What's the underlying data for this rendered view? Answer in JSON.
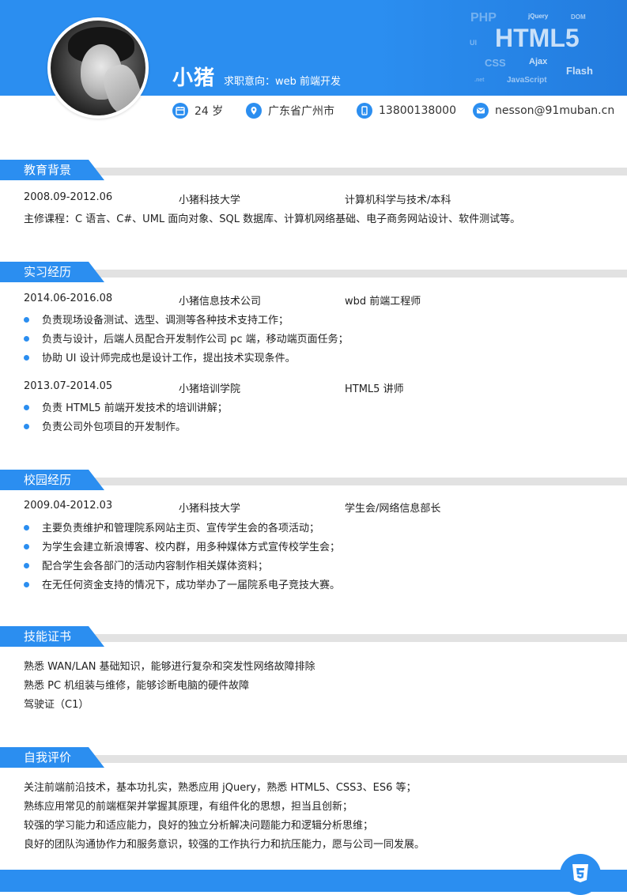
{
  "header": {
    "name": "小猪",
    "intent": "求职意向：web 前端开发",
    "keywords": {
      "html5": "HTML5",
      "php": "PHP",
      "jquery": "jQuery",
      "dom": "DOM",
      "ui": "UI",
      "css": "CSS",
      "ajax": "Ajax",
      "flash": "Flash",
      "javascript": "JavaScript",
      "net": ".net"
    }
  },
  "info": {
    "age": "24 岁",
    "city": "广东省广州市",
    "phone": "13800138000",
    "email": "nesson@91muban.cn"
  },
  "education": {
    "title": "教育背景",
    "period": "2008.09-2012.06",
    "school": "小猪科技大学",
    "major": "计算机科学与技术/本科",
    "courses": "主修课程：C 语言、C#、UML 面向对象、SQL 数据库、计算机网络基础、电子商务网站设计、软件测试等。"
  },
  "internship": {
    "title": "实习经历",
    "jobs": [
      {
        "period": "2014.06-2016.08",
        "company": "小猪信息技术公司",
        "role": "wbd 前端工程师",
        "duties": [
          "负责现场设备测试、选型、调测等各种技术支持工作；",
          "负责与设计，后端人员配合开发制作公司 pc 端，移动端页面任务；",
          "协助 UI 设计师完成也是设计工作，提出技术实现条件。"
        ]
      },
      {
        "period": "2013.07-2014.05",
        "company": "小猪培训学院",
        "role": "HTML5 讲师",
        "duties": [
          "负责 HTML5 前端开发技术的培训讲解；",
          "负责公司外包项目的开发制作。"
        ]
      }
    ]
  },
  "campus": {
    "title": "校园经历",
    "period": "2009.04-2012.03",
    "school": "小猪科技大学",
    "role": "学生会/网络信息部长",
    "items": [
      "主要负责维护和管理院系网站主页、宣传学生会的各项活动；",
      "为学生会建立新浪博客、校内群，用多种媒体方式宣传校学生会；",
      "配合学生会各部门的活动内容制作相关媒体资料；",
      "在无任何资金支持的情况下，成功举办了一届院系电子竞技大赛。"
    ]
  },
  "skills": {
    "title": "技能证书",
    "items": [
      "熟悉 WAN/LAN 基础知识，能够进行复杂和突发性网络故障排除",
      "熟悉 PC 机组装与维修，能够诊断电脑的硬件故障",
      "驾驶证（C1）"
    ]
  },
  "self": {
    "title": "自我评价",
    "items": [
      "关注前端前沿技术，基本功扎实，熟悉应用 jQuery，熟悉 HTML5、CSS3、ES6 等；",
      "熟练应用常见的前端框架并掌握其原理，有组件化的思想，担当且创新；",
      "较强的学习能力和适应能力，良好的独立分析解决问题能力和逻辑分析思维；",
      "良好的团队沟通协作力和服务意识，较强的工作执行力和抗压能力，愿与公司一同发展。"
    ]
  },
  "colors": {
    "accent": "#2b8ef0",
    "divider": "#e2e2e2"
  },
  "icons": [
    "calendar-icon",
    "location-icon",
    "phone-icon",
    "email-icon",
    "html5-icon"
  ]
}
